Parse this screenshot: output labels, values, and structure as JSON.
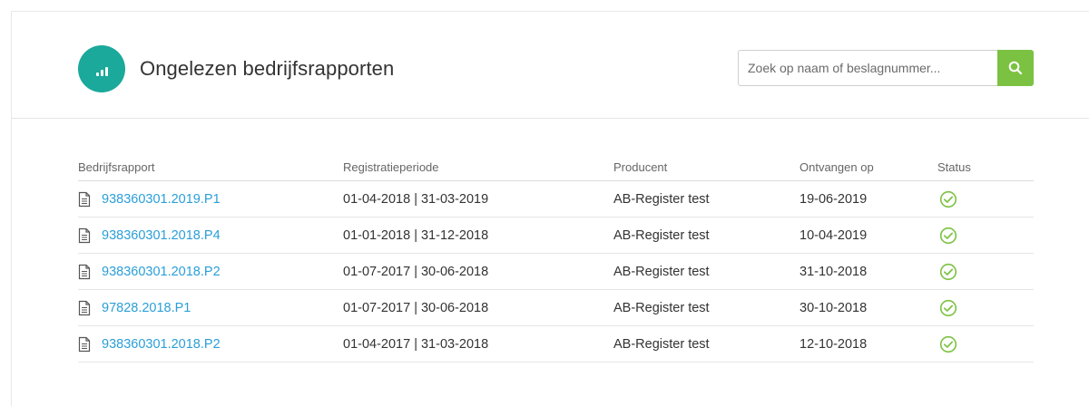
{
  "header": {
    "title": "Ongelezen bedrijfsrapporten",
    "badge_icon": "signal-bars-icon",
    "badge_color": "#1aa99a"
  },
  "search": {
    "placeholder": "Zoek op naam of beslagnummer...",
    "value": "",
    "button_icon": "search-icon",
    "button_color": "#7cc242"
  },
  "table": {
    "columns": [
      "Bedrijfsrapport",
      "Registratieperiode",
      "Producent",
      "Ontvangen op",
      "Status"
    ],
    "rows": [
      {
        "report": "938360301.2019.P1",
        "period": "01-04-2018 | 31-03-2019",
        "producer": "AB-Register test",
        "received": "19-06-2019",
        "status": "check-circle-icon"
      },
      {
        "report": "938360301.2018.P4",
        "period": "01-01-2018 | 31-12-2018",
        "producer": "AB-Register test",
        "received": "10-04-2019",
        "status": "check-circle-icon"
      },
      {
        "report": "938360301.2018.P2",
        "period": "01-07-2017 | 30-06-2018",
        "producer": "AB-Register test",
        "received": "31-10-2018",
        "status": "check-circle-icon"
      },
      {
        "report": "97828.2018.P1",
        "period": "01-07-2017 | 30-06-2018",
        "producer": "AB-Register test",
        "received": "30-10-2018",
        "status": "check-circle-icon"
      },
      {
        "report": "938360301.2018.P2",
        "period": "01-04-2017 | 31-03-2018",
        "producer": "AB-Register test",
        "received": "12-10-2018",
        "status": "check-circle-icon"
      }
    ],
    "link_color": "#2a9fd8",
    "status_color": "#7cc242"
  }
}
